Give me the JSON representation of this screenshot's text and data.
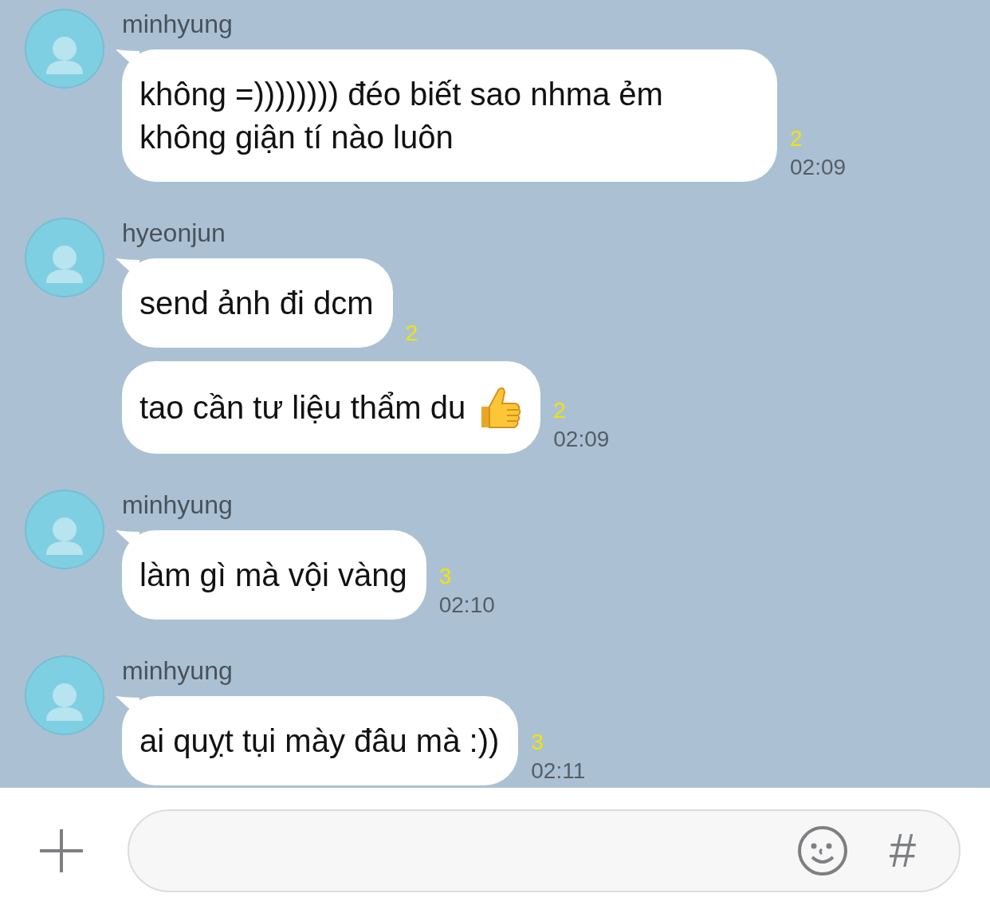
{
  "messages_groups": [
    {
      "sender": "minhyung",
      "messages": [
        {
          "kind": "text",
          "text": "không =)))))))) đéo biết sao nhma ẻm không giận tí nào luôn",
          "unread": "2",
          "time": "02:09"
        }
      ]
    },
    {
      "sender": "hyeonjun",
      "messages": [
        {
          "kind": "text",
          "text": "send ảnh đi dcm",
          "unread": "2"
        },
        {
          "kind": "text_with_thumbs_up",
          "text": "tao cần tư liệu thẩm du",
          "unread": "2",
          "time": "02:09"
        }
      ]
    },
    {
      "sender": "minhyung",
      "messages": [
        {
          "kind": "text",
          "text": "làm gì mà vội vàng",
          "unread": "3",
          "time": "02:10"
        }
      ]
    },
    {
      "sender": "minhyung",
      "messages": [
        {
          "kind": "text",
          "text": "ai quỵt tụi mày đâu mà :))",
          "unread": "3",
          "time": "02:11"
        }
      ]
    }
  ],
  "input_bar": {
    "hashtag": "#"
  }
}
